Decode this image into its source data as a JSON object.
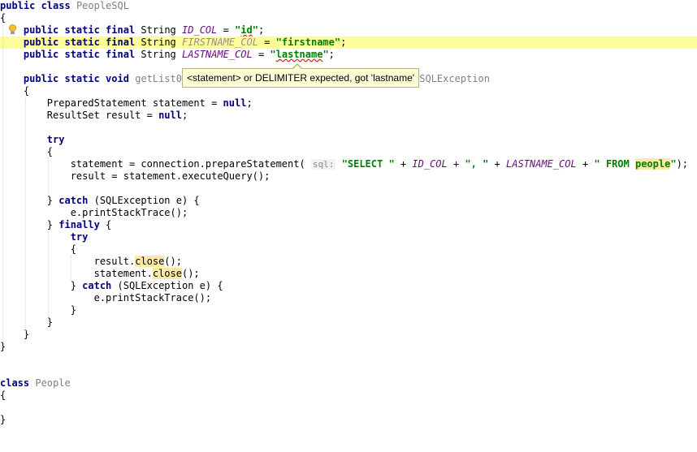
{
  "code": {
    "class_people_sql": {
      "kw": "public class",
      "name": "PeopleSQL"
    },
    "brace_open": "{",
    "brace_close": "}",
    "field_id": {
      "mods": "public static final",
      "type": "String",
      "name": "ID_COL",
      "eq": " = ",
      "q1": "\"",
      "value": "id",
      "q2": "\"",
      "semi": ";"
    },
    "field_firstname": {
      "mods": "public static final",
      "type": "String",
      "name": "FIRSTNAME_COL",
      "eq": " = ",
      "value": "\"firstname\"",
      "semi": ";"
    },
    "field_lastname": {
      "mods": "public static final",
      "type": "String",
      "name": "LASTNAME_COL",
      "eq": " = ",
      "q1": "\"",
      "value": "lastname",
      "q2": "\"",
      "semi": ";"
    },
    "method_sig": {
      "mods": "public static void",
      "name_start": "getList0",
      "tail": "aSQLException"
    },
    "decl_statement": {
      "type": "PreparedStatement statement = ",
      "null": "null",
      "semi": ";"
    },
    "decl_result": {
      "type": "ResultSet result = ",
      "null": "null",
      "semi": ";"
    },
    "try_kw": "try",
    "stmt_prepare": {
      "prefix": "statement = connection.prepareStatement( ",
      "hint": "sql:",
      "s1": "\"SELECT \"",
      "plus": " + ",
      "id_col": "ID_COL",
      "s2": "\", \"",
      "last_col": "LASTNAME_COL",
      "s3_open": "\" FROM ",
      "s3_table": "people",
      "s3_close": "\"",
      "suffix": ");"
    },
    "stmt_execute": "result = statement.executeQuery();",
    "catch_line": {
      "close": "} ",
      "kw": "catch",
      "rest": " (SQLException e) {"
    },
    "print_stack": "e.printStackTrace();",
    "finally_line": {
      "close": "} ",
      "kw": "finally",
      "rest": " {"
    },
    "result_close": {
      "obj": "result.",
      "method": "close",
      "tail": "();"
    },
    "statement_close": {
      "obj": "statement.",
      "method": "close",
      "tail": "();"
    },
    "class_people": {
      "kw": "class",
      "name": "People"
    }
  },
  "tooltip": {
    "text": "<statement> or DELIMITER expected, got 'lastname'"
  },
  "colors": {
    "keyword": "#000080",
    "field": "#660e7a",
    "string": "#008000",
    "highlight_line": "#fdfd9a",
    "usage_highlight": "#fbe9a6",
    "error_underline": "#e02020"
  },
  "icons": {
    "intention": "lightbulb-icon"
  }
}
